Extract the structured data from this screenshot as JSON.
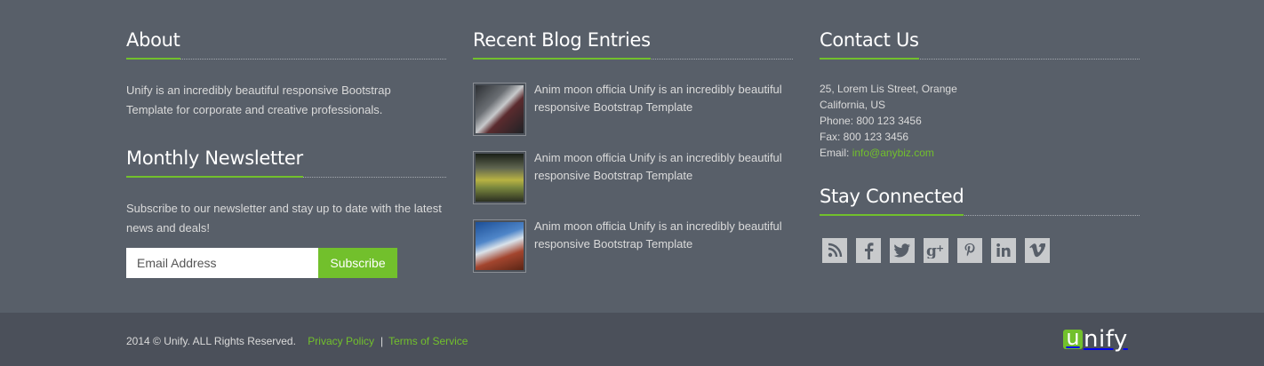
{
  "colors": {
    "accent": "#72c02c",
    "footer_bg": "#585f69",
    "bottom_bg": "#4b505a"
  },
  "about": {
    "title": "About",
    "text": "Unify is an incredibly beautiful responsive Bootstrap Template for corporate and creative professionals."
  },
  "newsletter": {
    "title": "Monthly Newsletter",
    "text": "Subscribe to our newsletter and stay up to date with the latest news and deals!",
    "input_placeholder": "Email Address",
    "button_label": "Subscribe"
  },
  "blog": {
    "title": "Recent Blog Entries",
    "entries": [
      {
        "text": "Anim moon officia Unify is an incredibly beautiful responsive Bootstrap Template"
      },
      {
        "text": "Anim moon officia Unify is an incredibly beautiful responsive Bootstrap Template"
      },
      {
        "text": "Anim moon officia Unify is an incredibly beautiful responsive Bootstrap Template"
      }
    ]
  },
  "contact": {
    "title": "Contact Us",
    "address_line1": "25, Lorem Lis Street, Orange",
    "address_line2": "California, US",
    "phone": "Phone: 800 123 3456",
    "fax": "Fax: 800 123 3456",
    "email_label": "Email:",
    "email": "info@anybiz.com"
  },
  "social": {
    "title": "Stay Connected",
    "icons": [
      "rss-icon",
      "facebook-icon",
      "twitter-icon",
      "google-plus-icon",
      "pinterest-icon",
      "linkedin-icon",
      "vimeo-icon"
    ]
  },
  "bottom": {
    "copyright": "2014 © Unify. ALL Rights Reserved.",
    "privacy": "Privacy Policy",
    "separator": "|",
    "terms": "Terms of Service",
    "logo_first": "u",
    "logo_rest": "nify"
  }
}
